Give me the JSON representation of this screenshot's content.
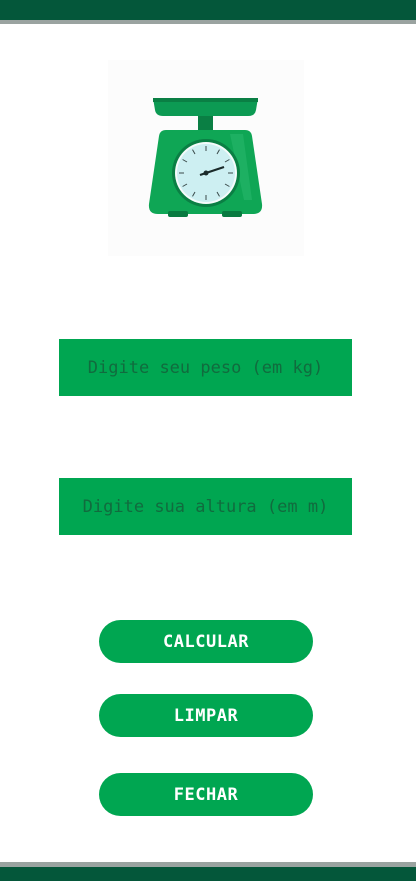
{
  "logo": {
    "icon": "scale-icon"
  },
  "form": {
    "weight_placeholder": "Digite seu peso (em kg)",
    "height_placeholder": "Digite sua altura (em m)"
  },
  "buttons": {
    "calculate": "CALCULAR",
    "clear": "LIMPAR",
    "close": "FECHAR"
  },
  "colors": {
    "app_bar": "#04573a",
    "accent": "#00a651",
    "button_text": "#ffffff"
  }
}
